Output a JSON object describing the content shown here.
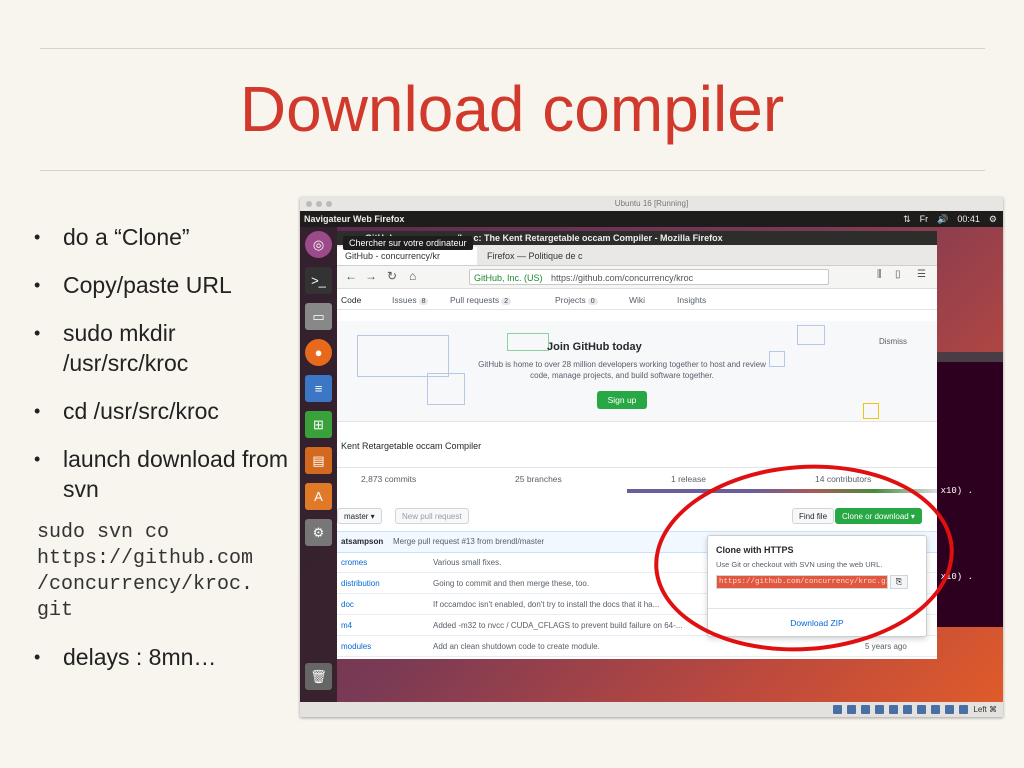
{
  "slide": {
    "title": "Download compiler",
    "bullets": [
      "do a “Clone”",
      "Copy/paste URL",
      "sudo mkdir /usr/src/kroc",
      "cd /usr/src/kroc",
      "launch download from svn"
    ],
    "code": "sudo svn co\nhttps://github.com\n/concurrency/kroc.\ngit",
    "last_bullet": "delays : 8mn…"
  },
  "vm": {
    "window_title": "Ubuntu 16 [Running]",
    "topbar_title": "Navigateur Web Firefox",
    "topbar_right": [
      "⇅",
      "Fr",
      "🔊",
      "00:41",
      "⚙"
    ],
    "status_right": "Left ⌘",
    "tooltip": "Chercher sur votre ordinateur",
    "terminal_lines": [
      "x10) .",
      "x10) ."
    ]
  },
  "firefox": {
    "title": "GitHub - concurrency/kroc: The Kent Retargetable occam Compiler - Mozilla Firefox",
    "tabs": [
      "GitHub - concurrency/kr",
      "Firefox — Politique de c"
    ],
    "url_secure": "GitHub, Inc. (US)",
    "url": "https://github.com/concurrency/kroc",
    "nav_buttons": [
      "←",
      "→",
      "↻",
      "⌂"
    ]
  },
  "github": {
    "repo_nav": [
      {
        "label": "Code",
        "count": ""
      },
      {
        "label": "Issues",
        "count": "8"
      },
      {
        "label": "Pull requests",
        "count": "2"
      },
      {
        "label": "Projects",
        "count": "0"
      },
      {
        "label": "Wiki",
        "count": ""
      },
      {
        "label": "Insights",
        "count": ""
      }
    ],
    "banner_title": "Join GitHub today",
    "banner_desc": "GitHub is home to over 28 million developers working together to host and review code, manage projects, and build software together.",
    "signup": "Sign up",
    "dismiss": "Dismiss",
    "description": "Kent Retargetable occam Compiler",
    "stats": [
      "2,873 commits",
      "25 branches",
      "1 release",
      "14 contributors"
    ],
    "branch": "master ▾",
    "new_pr": "New pull request",
    "find_file": "Find file",
    "clone_download": "Clone or download ▾",
    "commit_author": "atsampson",
    "commit_msg": "Merge pull request #13 from brendl/master",
    "files": [
      {
        "name": "cromes",
        "msg": "Various small fixes."
      },
      {
        "name": "distribution",
        "msg": "Going to commit and then merge these, too."
      },
      {
        "name": "doc",
        "msg": "If occamdoc isn't enabled, don't try to install the docs that it ha..."
      },
      {
        "name": "m4",
        "msg": "Added -m32 to nvcc / CUDA_CFLAGS to prevent build failure on 64-..."
      },
      {
        "name": "modules",
        "msg": "Add an clean shutdown code to create module."
      }
    ],
    "file_age": "5 years ago",
    "clone_title": "Clone with HTTPS",
    "clone_subtitle": "Use Git or checkout with SVN using the web URL.",
    "clone_url": "https://github.com/concurrency/kroc.git",
    "download_zip": "Download ZIP"
  },
  "colors": {
    "title_red": "#d0392b",
    "signup_green": "#28a745",
    "highlight_red": "#e01010"
  }
}
